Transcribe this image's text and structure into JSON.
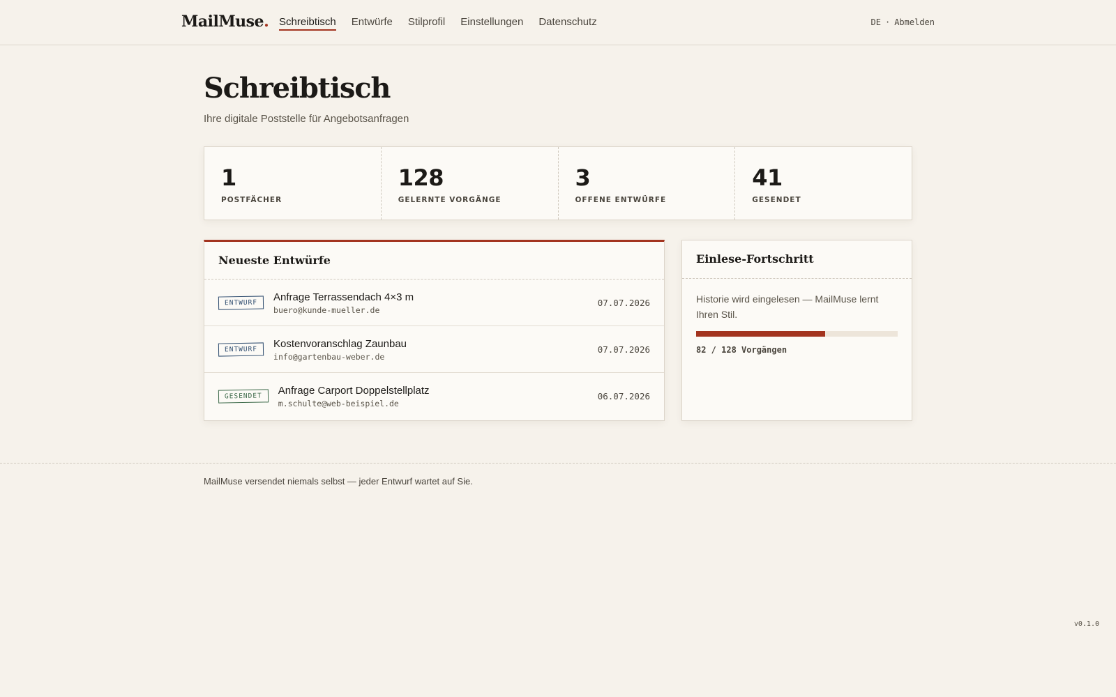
{
  "header": {
    "brand": "MailMuse",
    "brand_dot": ".",
    "nav": [
      {
        "label": "Schreibtisch",
        "active": true
      },
      {
        "label": "Entwürfe"
      },
      {
        "label": "Stilprofil"
      },
      {
        "label": "Einstellungen"
      },
      {
        "label": "Datenschutz"
      }
    ],
    "language": "DE",
    "separator": "·",
    "logout": "Abmelden"
  },
  "page": {
    "title": "Schreibtisch",
    "subtitle": "Ihre digitale Poststelle für Angebotsanfragen"
  },
  "stats": [
    {
      "value": "1",
      "label": "POSTFÄCHER"
    },
    {
      "value": "128",
      "label": "GELERNTE VORGÄNGE"
    },
    {
      "value": "3",
      "label": "OFFENE ENTWÜRFE"
    },
    {
      "value": "41",
      "label": "GESENDET"
    }
  ],
  "drafts": {
    "title": "Neueste Entwürfe",
    "items": [
      {
        "status": "ENTWURF",
        "subject": "Anfrage Terrassendach 4×3 m",
        "email": "buero@kunde-mueller.de",
        "date": "07.07.2026"
      },
      {
        "status": "ENTWURF",
        "subject": "Kostenvoranschlag Zaunbau",
        "email": "info@gartenbau-weber.de",
        "date": "07.07.2026"
      },
      {
        "status": "GESENDET",
        "subject": "Anfrage Carport Doppelstellplatz",
        "email": "m.schulte@web-beispiel.de",
        "date": "06.07.2026"
      }
    ]
  },
  "progress": {
    "title": "Einlese-Fortschritt",
    "text": "Historie wird eingelesen — MailMuse lernt Ihren Stil.",
    "current": 82,
    "total": 128,
    "count_label": "82 / 128 Vorgängen"
  },
  "footer": {
    "text": "MailMuse versendet niemals selbst — jeder Entwurf wartet auf Sie.",
    "version": "v0.1.0"
  },
  "colors": {
    "accent": "#a3341f",
    "draft_badge": "#2d4b6e",
    "sent_badge": "#3d6a4a",
    "background": "#f6f2eb"
  }
}
